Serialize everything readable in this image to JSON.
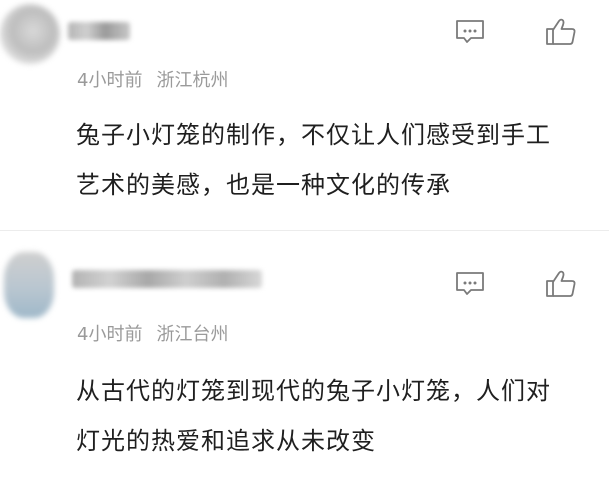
{
  "comments": [
    {
      "time": "4小时前",
      "location": "浙江杭州",
      "content_line1": "兔子小灯笼的制作，不仅让人们感受到手工",
      "content_line2": "艺术的美感，也是一种文化的传承",
      "reply_icon": "comment-bubble-icon",
      "like_icon": "thumbs-up-icon"
    },
    {
      "time": "4小时前",
      "location": "浙江台州",
      "content_line1": "从古代的灯笼到现代的兔子小灯笼，人们对",
      "content_line2": "灯光的热爱和追求从未改变",
      "reply_icon": "comment-bubble-icon",
      "like_icon": "thumbs-up-icon"
    }
  ],
  "colors": {
    "text": "#1f1f1f",
    "meta": "#9a9a9a",
    "icon": "#7a7a7a",
    "divider": "#ececec"
  }
}
